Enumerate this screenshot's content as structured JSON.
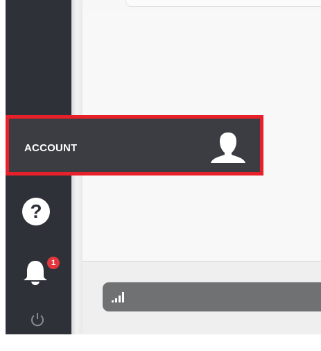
{
  "sidebar": {
    "account": {
      "label": "ACCOUNT",
      "icon": "user-icon"
    },
    "help": {
      "glyph": "?",
      "icon": "help-icon"
    },
    "notifications": {
      "icon": "bell-icon",
      "badge": "1"
    },
    "power": {
      "icon": "power-icon"
    }
  },
  "main": {
    "stats_bar": {
      "icon": "bar-chart-icon"
    }
  },
  "colors": {
    "sidebar_bg": "#2f3139",
    "highlight_border": "#e8202a",
    "badge": "#e4363d",
    "stats_bar": "#707173"
  }
}
